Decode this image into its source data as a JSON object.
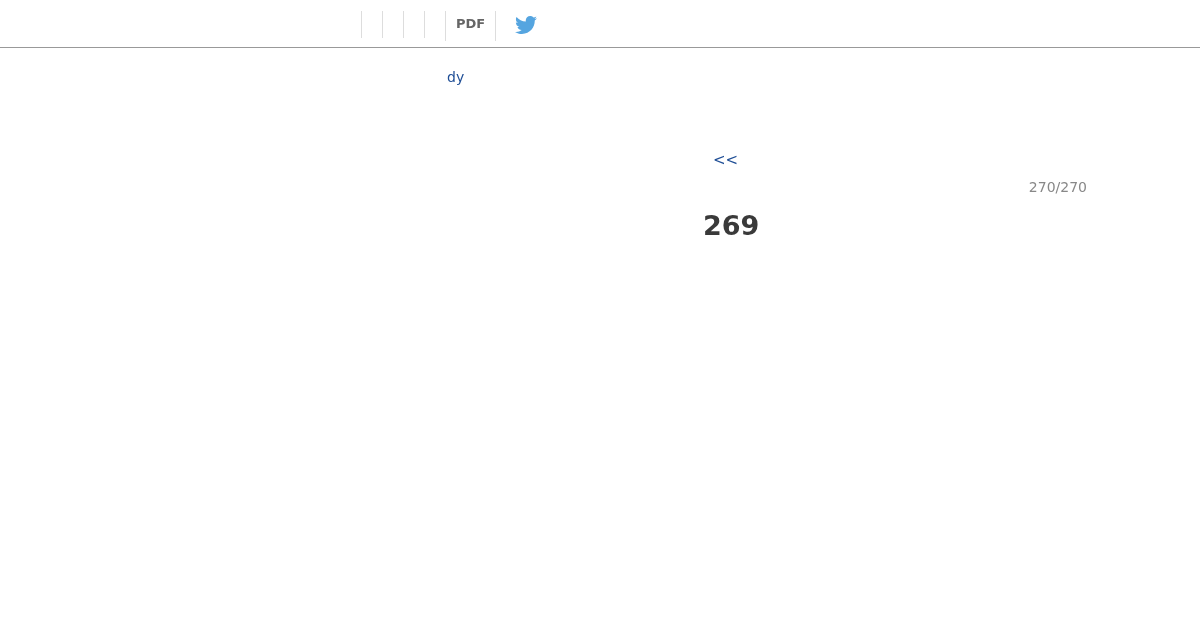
{
  "toolbar": {
    "pdf_link": "PDF"
  },
  "back_link": "dy",
  "prev_link": "<<",
  "page_counter": "270/270",
  "page_number": "269"
}
